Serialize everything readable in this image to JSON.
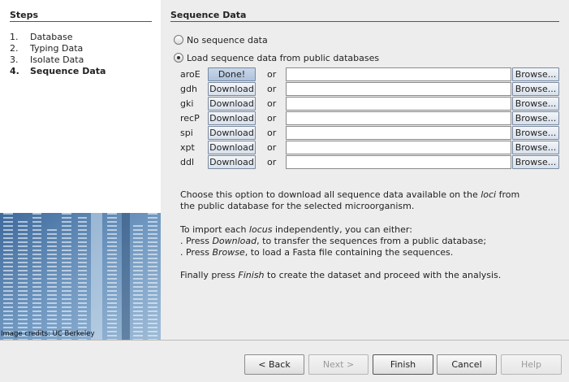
{
  "steps": {
    "title": "Steps",
    "items": [
      {
        "num": "1.",
        "label": "Database"
      },
      {
        "num": "2.",
        "label": "Typing Data"
      },
      {
        "num": "3.",
        "label": "Isolate Data"
      },
      {
        "num": "4.",
        "label": "Sequence Data",
        "active": true
      }
    ]
  },
  "image_credit": "Image credits: UC Berkeley",
  "section_title": "Sequence Data",
  "options": {
    "no_data_label": "No sequence data",
    "load_label": "Load sequence data from public databases",
    "selected": "load"
  },
  "loci": [
    {
      "name": "aroE",
      "button": "Done!",
      "or": "or",
      "browse": "Browse...",
      "path": ""
    },
    {
      "name": "gdh",
      "button": "Download",
      "or": "or",
      "browse": "Browse...",
      "path": ""
    },
    {
      "name": "gki",
      "button": "Download",
      "or": "or",
      "browse": "Browse...",
      "path": ""
    },
    {
      "name": "recP",
      "button": "Download",
      "or": "or",
      "browse": "Browse...",
      "path": ""
    },
    {
      "name": "spi",
      "button": "Download",
      "or": "or",
      "browse": "Browse...",
      "path": ""
    },
    {
      "name": "xpt",
      "button": "Download",
      "or": "or",
      "browse": "Browse...",
      "path": ""
    },
    {
      "name": "ddl",
      "button": "Download",
      "or": "or",
      "browse": "Browse...",
      "path": ""
    }
  ],
  "description": {
    "p1_a": "Choose this option to download all sequence data available on the ",
    "p1_em": "loci",
    "p1_b": " from",
    "p1_line2": "the public database for the selected microorganism.",
    "p2_a": "To import each ",
    "p2_em": "locus",
    "p2_b": " independently, you can either:",
    "p3_a": ". Press ",
    "p3_em": "Download",
    "p3_b": ", to transfer the sequences from a public database;",
    "p4_a": ". Press ",
    "p4_em": "Browse",
    "p4_b": ", to load a Fasta file containing the sequences.",
    "p5_a": "Finally press ",
    "p5_em": "Finish",
    "p5_b": " to create the dataset and proceed with the analysis."
  },
  "nav": {
    "back": "< Back",
    "next": "Next >",
    "finish": "Finish",
    "cancel": "Cancel",
    "help": "Help"
  }
}
